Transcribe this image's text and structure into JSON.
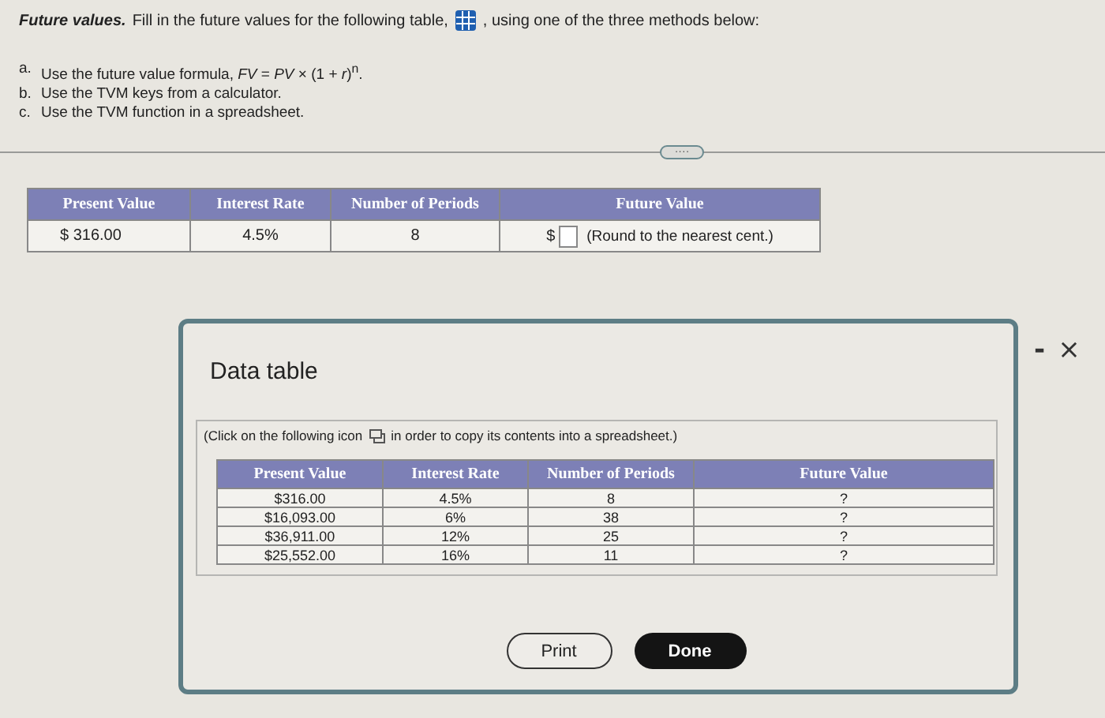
{
  "question": {
    "title": "Future values.",
    "text_before": "Fill in the future values for the following table,",
    "text_after": ", using one of the three methods below:"
  },
  "methods": [
    {
      "letter": "a.",
      "text": "Use the future value formula, *FV* = *PV* × (1 + *r*)$^{n}$."
    },
    {
      "letter": "b.",
      "text": "Use the TVM keys from a calculator."
    },
    {
      "letter": "c.",
      "text": "Use the TVM function in a spreadsheet."
    }
  ],
  "expand_button": "····",
  "answer_table": {
    "columns": [
      "Present Value",
      "Interest Rate",
      "Number of Periods",
      "Future Value"
    ],
    "row": {
      "present_value": "$  316.00",
      "interest_rate": "4.5%",
      "periods": "8",
      "currency": "$",
      "hint": "(Round to the nearest cent.)"
    }
  },
  "dialog": {
    "title": "Data table",
    "note_before": "(Click on the following icon",
    "note_after": "in order to copy its contents into a spreadsheet.)",
    "columns": [
      "Present Value",
      "Interest Rate",
      "Number of Periods",
      "Future Value"
    ],
    "rows": [
      [
        "$316.00",
        "4.5%",
        "8",
        "?"
      ],
      [
        "$16,093.00",
        "6%",
        "38",
        "?"
      ],
      [
        "$36,911.00",
        "12%",
        "25",
        "?"
      ],
      [
        "$25,552.00",
        "16%",
        "11",
        "?"
      ]
    ],
    "buttons": [
      {
        "label": "Print",
        "kind": "outline"
      },
      {
        "label": "Done",
        "kind": "primary"
      }
    ]
  },
  "window_controls": [
    {
      "label": "-",
      "kind": "minimize"
    },
    {
      "label": "×",
      "kind": "close"
    }
  ]
}
